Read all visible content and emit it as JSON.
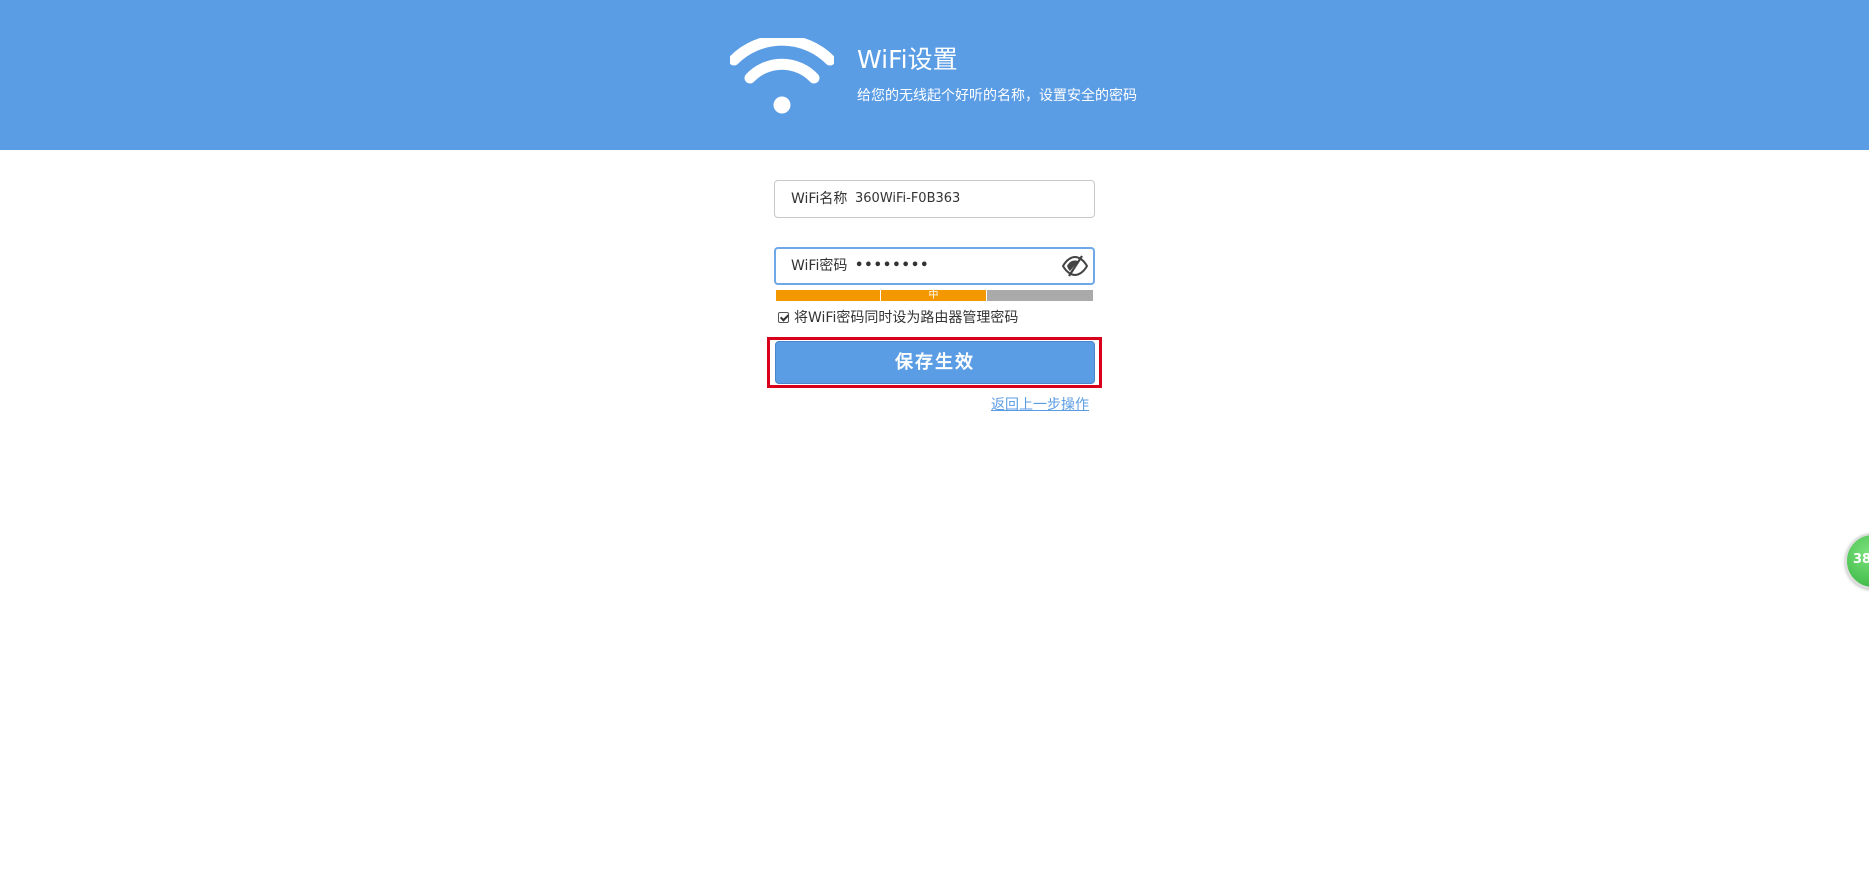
{
  "header": {
    "title": "WiFi设置",
    "subtitle": "给您的无线起个好听的名称，设置安全的密码",
    "logo_icon": "wifi-icon",
    "bg_color": "#5b9de4"
  },
  "form": {
    "name_field": {
      "label": "WiFi名称",
      "value": "360WiFi-F0B363"
    },
    "password_field": {
      "label": "WiFi密码",
      "value": "••••••••",
      "toggle_icon": "eye-slash-icon"
    },
    "strength": {
      "label": "中",
      "level": 2,
      "max_level": 3,
      "active_color": "#f39800",
      "inactive_color": "#aaaaaa"
    },
    "sync_checkbox": {
      "label": "将WiFi密码同时设为路由器管理密码",
      "checked": true
    },
    "save_button": "保存生效",
    "back_link": "返回上一步操作"
  },
  "float_badge": {
    "text": "38",
    "color": "#2fb03a"
  }
}
